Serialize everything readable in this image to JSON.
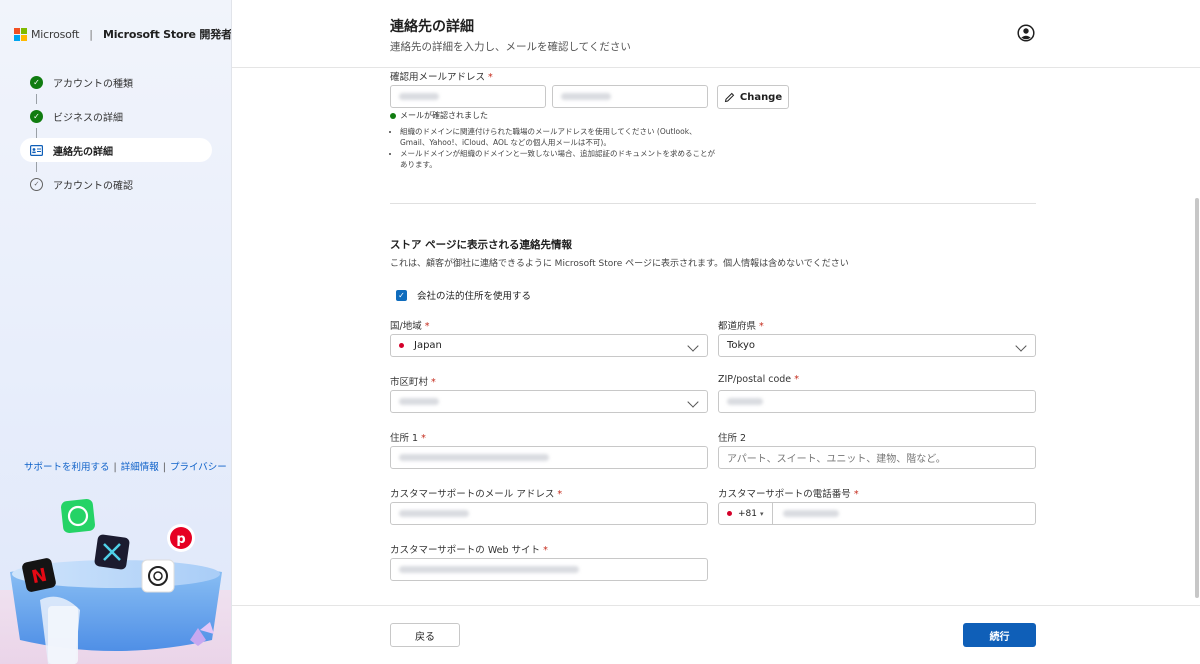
{
  "brand": {
    "microsoft": "Microsoft",
    "separator": "|",
    "store": "Microsoft Store 開発者"
  },
  "steps": [
    {
      "label": "アカウントの種類",
      "status": "done"
    },
    {
      "label": "ビジネスの詳細",
      "status": "done"
    },
    {
      "label": "連絡先の詳細",
      "status": "active"
    },
    {
      "label": "アカウントの確認",
      "status": "pending"
    }
  ],
  "footer_links": {
    "support": "サポートを利用する",
    "details": "詳細情報",
    "privacy": "プライバシー",
    "sep": "|"
  },
  "header": {
    "title": "連絡先の詳細",
    "subtitle": "連絡先の詳細を入力し、メールを確認してください"
  },
  "email_section": {
    "label": "確認用メールアドレス",
    "required_mark": "*",
    "change_label": "Change",
    "verified_text": "メールが確認されました",
    "notes": [
      "組織のドメインに関連付けられた職場のメールアドレスを使用してください (Outlook、Gmail、Yahoo!、iCloud、AOL などの個人用メールは不可)。",
      "メールドメインが組織のドメインと一致しない場合、追加認証のドキュメントを求めることがあります。"
    ]
  },
  "store_contact": {
    "title": "ストア ページに表示される連絡先情報",
    "description": "これは、顧客が御社に連絡できるように Microsoft Store ページに表示されます。個人情報は含めないでください",
    "use_legal_address_label": "会社の法的住所を使用する",
    "country_label": "国/地域",
    "country_value": "Japan",
    "prefecture_label": "都道府県",
    "prefecture_value": "Tokyo",
    "city_label": "市区町村",
    "zip_label": "ZIP/postal code",
    "address1_label": "住所 1",
    "address2_label": "住所 2",
    "address2_placeholder": "アパート、スイート、ユニット、建物、階など。",
    "support_email_label": "カスタマーサポートのメール アドレス",
    "support_phone_label": "カスタマーサポートの電話番号",
    "phone_code": "+81",
    "support_website_label": "カスタマーサポートの Web サイト",
    "required_mark": "*"
  },
  "footer_buttons": {
    "back": "戻る",
    "next": "続行"
  },
  "colors": {
    "accent": "#0f5fb8",
    "success": "#107c10",
    "required": "#c42b1c",
    "link": "#0f62c9"
  }
}
